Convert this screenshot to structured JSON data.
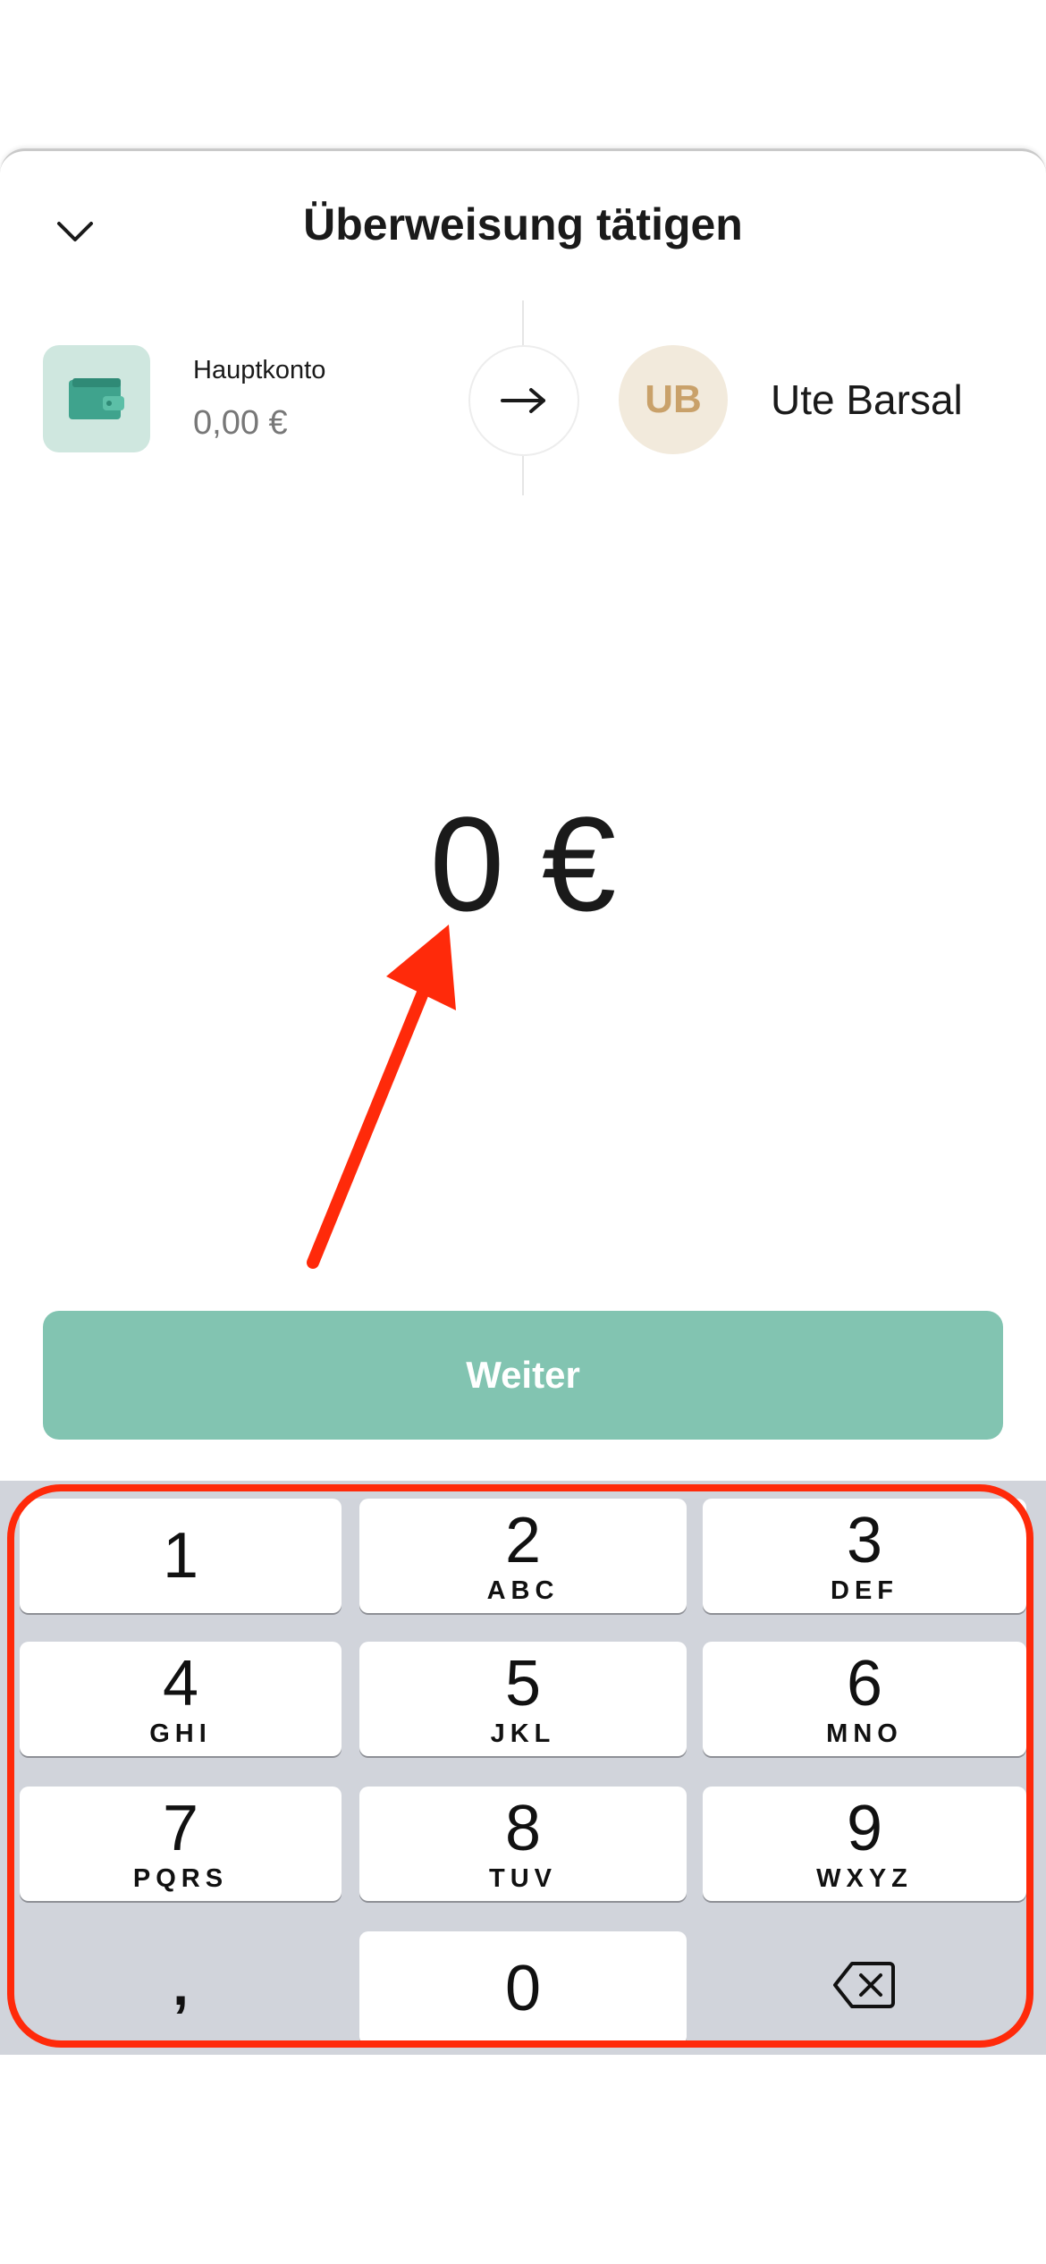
{
  "sheet": {
    "title": "Überweisung tätigen"
  },
  "source_account": {
    "name": "Hauptkonto",
    "balance": "0,00 €"
  },
  "recipient": {
    "initials": "UB",
    "name": "Ute Barsal"
  },
  "amount": {
    "value": "0 €"
  },
  "continue_button": {
    "label": "Weiter"
  },
  "keypad": {
    "keys": [
      {
        "digit": "1",
        "letters": ""
      },
      {
        "digit": "2",
        "letters": "ABC"
      },
      {
        "digit": "3",
        "letters": "DEF"
      },
      {
        "digit": "4",
        "letters": "GHI"
      },
      {
        "digit": "5",
        "letters": "JKL"
      },
      {
        "digit": "6",
        "letters": "MNO"
      },
      {
        "digit": "7",
        "letters": "PQRS"
      },
      {
        "digit": "8",
        "letters": "TUV"
      },
      {
        "digit": "9",
        "letters": "WXYZ"
      },
      {
        "digit": ",",
        "letters": ""
      },
      {
        "digit": "0",
        "letters": ""
      }
    ]
  },
  "colors": {
    "accent": "#82c4b1",
    "annotation": "#ff2a0a",
    "avatar_bg": "#f2eadc",
    "avatar_text": "#c9a16a",
    "keypad_bg": "#d1d4db"
  }
}
